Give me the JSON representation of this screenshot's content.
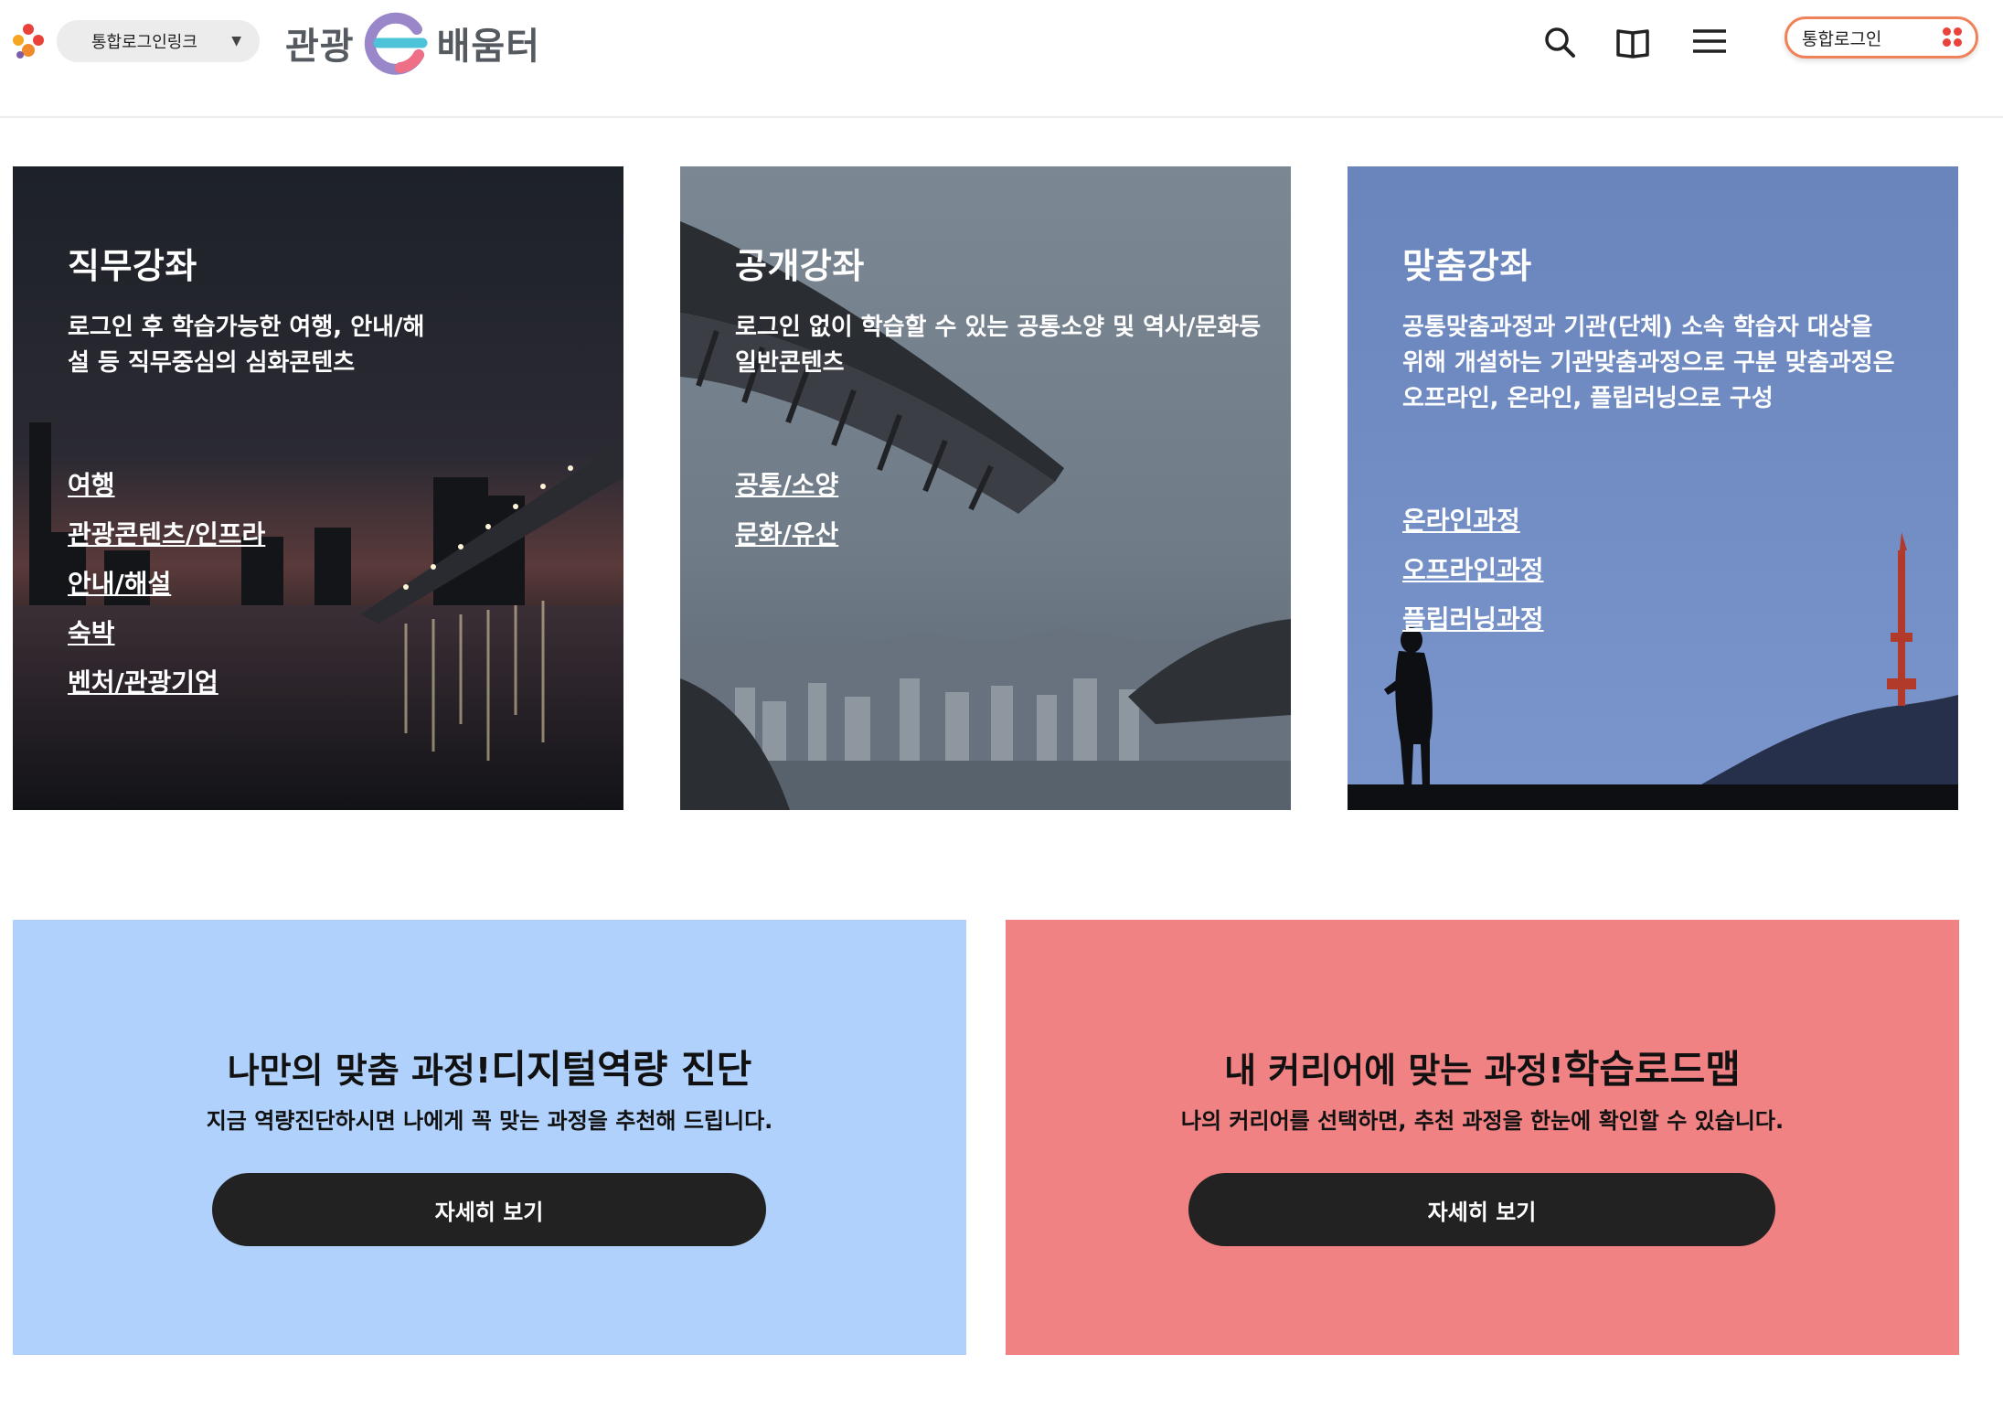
{
  "header": {
    "login_link_select": "통합로그인링크",
    "logo_left": "관광",
    "logo_right": "배움터",
    "login_button": "통합로그인"
  },
  "cards": [
    {
      "title": "직무강좌",
      "desc_line1": "로그인 후 학습가능한 여행, 안내/해",
      "desc_line2": "설 등 직무중심의 심화콘텐츠",
      "links": [
        "여행",
        "관광콘텐츠/인프라",
        "안내/해설",
        "숙박",
        "벤처/관광기업"
      ]
    },
    {
      "title": "공개강좌",
      "desc_line1": "로그인 없이 학습할 수 있는 공통소양 및 역사/문화등",
      "desc_line2": "일반콘텐츠",
      "links": [
        "공통/소양",
        "문화/유산"
      ]
    },
    {
      "title": "맞춤강좌",
      "desc_line1": "공통맞춤과정과 기관(단체) 소속 학습자 대상을",
      "desc_line2": "위해 개설하는 기관맞춤과정으로 구분 맞춤과정은",
      "desc_line3": "오프라인, 온라인, 플립러닝으로 구성",
      "links": [
        "온라인과정",
        "오프라인과정",
        "플립러닝과정"
      ]
    }
  ],
  "banners": [
    {
      "title_prefix": "나만의 맞춤 과정!",
      "title_main": "디지털역량 진단",
      "desc": "지금 역량진단하시면 나에게 꼭 맞는 과정을 추천해 드립니다.",
      "button": "자세히 보기",
      "bg": "#afd1fb"
    },
    {
      "title_prefix": "내 커리어에 맞는 과정!",
      "title_main": "학습로드맵",
      "desc": "나의 커리어를 선택하면, 추천 과정을 한눈에 확인할 수 있습니다.",
      "button": "자세히 보기",
      "bg": "#f08284"
    }
  ],
  "colors": {
    "login_border": "#f0825a",
    "button_dark": "#222222",
    "card3_sky": "#6b86bd"
  },
  "icons": [
    "brand-mark-icon",
    "search-icon",
    "book-icon",
    "menu-icon",
    "dots-grid-icon"
  ]
}
